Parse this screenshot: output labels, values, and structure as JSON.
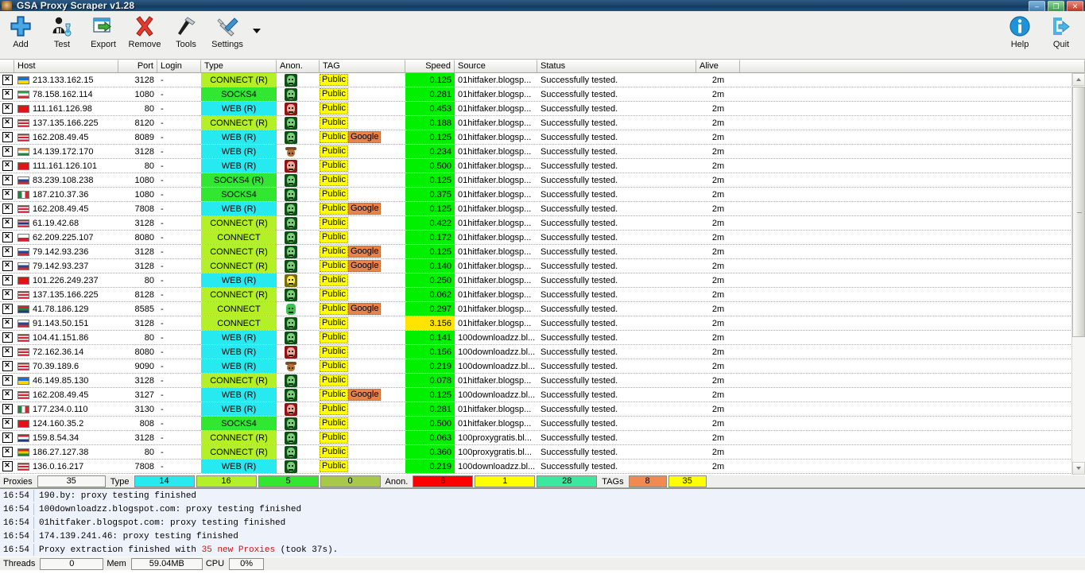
{
  "window": {
    "title": "GSA Proxy Scraper v1.28",
    "icon": "app-icon",
    "minimize_label": "–",
    "maximize_label": "❐",
    "close_label": "✕"
  },
  "toolbar": {
    "buttons": [
      {
        "label": "Add",
        "icon": "plus-icon"
      },
      {
        "label": "Test",
        "icon": "person-flask-icon"
      },
      {
        "label": "Export",
        "icon": "export-arrow-icon"
      },
      {
        "label": "Remove",
        "icon": "red-x-icon"
      },
      {
        "label": "Tools",
        "icon": "hammer-icon"
      },
      {
        "label": "Settings",
        "icon": "wrench-screwdriver-icon"
      }
    ],
    "overflow_icon": "chevron-down-icon",
    "right_buttons": [
      {
        "label": "Help",
        "icon": "info-icon"
      },
      {
        "label": "Quit",
        "icon": "exit-icon"
      }
    ]
  },
  "table": {
    "columns": [
      {
        "key": "check",
        "label": "",
        "align": "left"
      },
      {
        "key": "host",
        "label": "Host",
        "align": "left"
      },
      {
        "key": "port",
        "label": "Port",
        "align": "right"
      },
      {
        "key": "login",
        "label": "Login",
        "align": "left"
      },
      {
        "key": "type",
        "label": "Type",
        "align": "left"
      },
      {
        "key": "anon",
        "label": "Anon.",
        "align": "left"
      },
      {
        "key": "tag",
        "label": "TAG",
        "align": "left"
      },
      {
        "key": "speed",
        "label": "Speed",
        "align": "right"
      },
      {
        "key": "source",
        "label": "Source",
        "align": "left"
      },
      {
        "key": "status",
        "label": "Status",
        "align": "left"
      },
      {
        "key": "alive",
        "label": "Alive",
        "align": "left"
      }
    ],
    "rows": [
      {
        "checked": true,
        "flag": "ua",
        "host": "213.133.162.15",
        "port": "3128",
        "login": "-",
        "type": "CONNECT (R)",
        "type_color": "#b4f028",
        "anon": "elite",
        "tags": [
          "Public"
        ],
        "speed": "0.125",
        "speed_color": "#00f000",
        "source": "01hitfaker.blogsp...",
        "status": "Successfully tested.",
        "alive": "2m"
      },
      {
        "checked": true,
        "flag": "ir",
        "host": "78.158.162.114",
        "port": "1080",
        "login": "-",
        "type": "SOCKS4",
        "type_color": "#32e632",
        "anon": "elite",
        "tags": [
          "Public"
        ],
        "speed": "0.281",
        "speed_color": "#00f000",
        "source": "01hitfaker.blogsp...",
        "status": "Successfully tested.",
        "alive": "2m"
      },
      {
        "checked": true,
        "flag": "cn",
        "host": "111.161.126.98",
        "port": "80",
        "login": "-",
        "type": "WEB (R)",
        "type_color": "#27e9f0",
        "anon": "trans",
        "tags": [
          "Public"
        ],
        "speed": "0.453",
        "speed_color": "#00f000",
        "source": "01hitfaker.blogsp...",
        "status": "Successfully tested.",
        "alive": "2m"
      },
      {
        "checked": true,
        "flag": "us",
        "host": "137.135.166.225",
        "port": "8120",
        "login": "-",
        "type": "CONNECT (R)",
        "type_color": "#b4f028",
        "anon": "elite",
        "tags": [
          "Public"
        ],
        "speed": "0.188",
        "speed_color": "#00f000",
        "source": "01hitfaker.blogsp...",
        "status": "Successfully tested.",
        "alive": "2m"
      },
      {
        "checked": true,
        "flag": "us",
        "host": "162.208.49.45",
        "port": "8089",
        "login": "-",
        "type": "WEB (R)",
        "type_color": "#27e9f0",
        "anon": "elite",
        "tags": [
          "Public",
          "Google"
        ],
        "speed": "0.125",
        "speed_color": "#00f000",
        "source": "01hitfaker.blogsp...",
        "status": "Successfully tested.",
        "alive": "2m"
      },
      {
        "checked": true,
        "flag": "in",
        "host": "14.139.172.170",
        "port": "3128",
        "login": "-",
        "type": "WEB (R)",
        "type_color": "#27e9f0",
        "anon": "anon",
        "tags": [
          "Public"
        ],
        "speed": "0.234",
        "speed_color": "#00f000",
        "source": "01hitfaker.blogsp...",
        "status": "Successfully tested.",
        "alive": "2m"
      },
      {
        "checked": true,
        "flag": "cn",
        "host": "111.161.126.101",
        "port": "80",
        "login": "-",
        "type": "WEB (R)",
        "type_color": "#27e9f0",
        "anon": "trans",
        "tags": [
          "Public"
        ],
        "speed": "0.500",
        "speed_color": "#00f000",
        "source": "01hitfaker.blogsp...",
        "status": "Successfully tested.",
        "alive": "2m"
      },
      {
        "checked": true,
        "flag": "ru",
        "host": "83.239.108.238",
        "port": "1080",
        "login": "-",
        "type": "SOCKS4 (R)",
        "type_color": "#32e632",
        "anon": "elite",
        "tags": [
          "Public"
        ],
        "speed": "0.125",
        "speed_color": "#00f000",
        "source": "01hitfaker.blogsp...",
        "status": "Successfully tested.",
        "alive": "2m"
      },
      {
        "checked": true,
        "flag": "mx",
        "host": "187.210.37.36",
        "port": "1080",
        "login": "-",
        "type": "SOCKS4",
        "type_color": "#32e632",
        "anon": "elite",
        "tags": [
          "Public"
        ],
        "speed": "0.375",
        "speed_color": "#00f000",
        "source": "01hitfaker.blogsp...",
        "status": "Successfully tested.",
        "alive": "2m"
      },
      {
        "checked": true,
        "flag": "us",
        "host": "162.208.49.45",
        "port": "7808",
        "login": "-",
        "type": "WEB (R)",
        "type_color": "#27e9f0",
        "anon": "elite",
        "tags": [
          "Public",
          "Google"
        ],
        "speed": "0.125",
        "speed_color": "#00f000",
        "source": "01hitfaker.blogsp...",
        "status": "Successfully tested.",
        "alive": "2m"
      },
      {
        "checked": true,
        "flag": "th",
        "host": "61.19.42.68",
        "port": "3128",
        "login": "-",
        "type": "CONNECT (R)",
        "type_color": "#b4f028",
        "anon": "elite",
        "tags": [
          "Public"
        ],
        "speed": "0.422",
        "speed_color": "#00f000",
        "source": "01hitfaker.blogsp...",
        "status": "Successfully tested.",
        "alive": "2m"
      },
      {
        "checked": true,
        "flag": "cz",
        "host": "62.209.225.107",
        "port": "8080",
        "login": "-",
        "type": "CONNECT",
        "type_color": "#b4f028",
        "anon": "elite",
        "tags": [
          "Public"
        ],
        "speed": "0.172",
        "speed_color": "#00f000",
        "source": "01hitfaker.blogsp...",
        "status": "Successfully tested.",
        "alive": "2m"
      },
      {
        "checked": true,
        "flag": "ru",
        "host": "79.142.93.236",
        "port": "3128",
        "login": "-",
        "type": "CONNECT (R)",
        "type_color": "#b4f028",
        "anon": "elite",
        "tags": [
          "Public",
          "Google"
        ],
        "speed": "0.125",
        "speed_color": "#00f000",
        "source": "01hitfaker.blogsp...",
        "status": "Successfully tested.",
        "alive": "2m"
      },
      {
        "checked": true,
        "flag": "ru",
        "host": "79.142.93.237",
        "port": "3128",
        "login": "-",
        "type": "CONNECT (R)",
        "type_color": "#b4f028",
        "anon": "elite",
        "tags": [
          "Public",
          "Google"
        ],
        "speed": "0.140",
        "speed_color": "#00f000",
        "source": "01hitfaker.blogsp...",
        "status": "Successfully tested.",
        "alive": "2m"
      },
      {
        "checked": true,
        "flag": "cn",
        "host": "101.226.249.237",
        "port": "80",
        "login": "-",
        "type": "WEB (R)",
        "type_color": "#27e9f0",
        "anon": "yellow",
        "tags": [
          "Public"
        ],
        "speed": "0.250",
        "speed_color": "#00f000",
        "source": "01hitfaker.blogsp...",
        "status": "Successfully tested.",
        "alive": "2m"
      },
      {
        "checked": true,
        "flag": "us",
        "host": "137.135.166.225",
        "port": "8128",
        "login": "-",
        "type": "CONNECT (R)",
        "type_color": "#b4f028",
        "anon": "elite",
        "tags": [
          "Public"
        ],
        "speed": "0.062",
        "speed_color": "#00f000",
        "source": "01hitfaker.blogsp...",
        "status": "Successfully tested.",
        "alive": "2m"
      },
      {
        "checked": true,
        "flag": "za",
        "host": "41.78.186.129",
        "port": "8585",
        "login": "-",
        "type": "CONNECT",
        "type_color": "#b4f028",
        "anon": "green",
        "tags": [
          "Public",
          "Google"
        ],
        "speed": "0.297",
        "speed_color": "#00f000",
        "source": "01hitfaker.blogsp...",
        "status": "Successfully tested.",
        "alive": "2m"
      },
      {
        "checked": true,
        "flag": "ru",
        "host": "91.143.50.151",
        "port": "3128",
        "login": "-",
        "type": "CONNECT",
        "type_color": "#b4f028",
        "anon": "elite",
        "tags": [
          "Public"
        ],
        "speed": "3.156",
        "speed_color": "#ffe400",
        "source": "01hitfaker.blogsp...",
        "status": "Successfully tested.",
        "alive": "2m"
      },
      {
        "checked": true,
        "flag": "us",
        "host": "104.41.151.86",
        "port": "80",
        "login": "-",
        "type": "WEB (R)",
        "type_color": "#27e9f0",
        "anon": "elite",
        "tags": [
          "Public"
        ],
        "speed": "0.141",
        "speed_color": "#00f000",
        "source": "100downloadzz.bl...",
        "status": "Successfully tested.",
        "alive": "2m"
      },
      {
        "checked": true,
        "flag": "us",
        "host": "72.162.36.14",
        "port": "8080",
        "login": "-",
        "type": "WEB (R)",
        "type_color": "#27e9f0",
        "anon": "trans",
        "tags": [
          "Public"
        ],
        "speed": "0.156",
        "speed_color": "#00f000",
        "source": "100downloadzz.bl...",
        "status": "Successfully tested.",
        "alive": "2m"
      },
      {
        "checked": true,
        "flag": "us",
        "host": "70.39.189.6",
        "port": "9090",
        "login": "-",
        "type": "WEB (R)",
        "type_color": "#27e9f0",
        "anon": "anon",
        "tags": [
          "Public"
        ],
        "speed": "0.219",
        "speed_color": "#00f000",
        "source": "100downloadzz.bl...",
        "status": "Successfully tested.",
        "alive": "2m"
      },
      {
        "checked": true,
        "flag": "ua",
        "host": "46.149.85.130",
        "port": "3128",
        "login": "-",
        "type": "CONNECT (R)",
        "type_color": "#b4f028",
        "anon": "elite",
        "tags": [
          "Public"
        ],
        "speed": "0.078",
        "speed_color": "#00f000",
        "source": "01hitfaker.blogsp...",
        "status": "Successfully tested.",
        "alive": "2m"
      },
      {
        "checked": true,
        "flag": "us",
        "host": "162.208.49.45",
        "port": "3127",
        "login": "-",
        "type": "WEB (R)",
        "type_color": "#27e9f0",
        "anon": "elite",
        "tags": [
          "Public",
          "Google"
        ],
        "speed": "0.125",
        "speed_color": "#00f000",
        "source": "100downloadzz.bl...",
        "status": "Successfully tested.",
        "alive": "2m"
      },
      {
        "checked": true,
        "flag": "mx",
        "host": "177.234.0.110",
        "port": "3130",
        "login": "-",
        "type": "WEB (R)",
        "type_color": "#27e9f0",
        "anon": "trans",
        "tags": [
          "Public"
        ],
        "speed": "0.281",
        "speed_color": "#00f000",
        "source": "01hitfaker.blogsp...",
        "status": "Successfully tested.",
        "alive": "2m"
      },
      {
        "checked": true,
        "flag": "cn",
        "host": "124.160.35.2",
        "port": "808",
        "login": "-",
        "type": "SOCKS4",
        "type_color": "#32e632",
        "anon": "elite",
        "tags": [
          "Public"
        ],
        "speed": "0.500",
        "speed_color": "#00f000",
        "source": "01hitfaker.blogsp...",
        "status": "Successfully tested.",
        "alive": "2m"
      },
      {
        "checked": true,
        "flag": "nl",
        "host": "159.8.54.34",
        "port": "3128",
        "login": "-",
        "type": "CONNECT (R)",
        "type_color": "#b4f028",
        "anon": "elite",
        "tags": [
          "Public"
        ],
        "speed": "0.063",
        "speed_color": "#00f000",
        "source": "100proxygratis.bl...",
        "status": "Successfully tested.",
        "alive": "2m"
      },
      {
        "checked": true,
        "flag": "bo",
        "host": "186.27.127.38",
        "port": "80",
        "login": "-",
        "type": "CONNECT (R)",
        "type_color": "#b4f028",
        "anon": "elite",
        "tags": [
          "Public"
        ],
        "speed": "0.360",
        "speed_color": "#00f000",
        "source": "100proxygratis.bl...",
        "status": "Successfully tested.",
        "alive": "2m"
      },
      {
        "checked": true,
        "flag": "us",
        "host": "136.0.16.217",
        "port": "7808",
        "login": "-",
        "type": "WEB (R)",
        "type_color": "#27e9f0",
        "anon": "elite",
        "tags": [
          "Public"
        ],
        "speed": "0.219",
        "speed_color": "#00f000",
        "source": "100downloadzz.bl...",
        "status": "Successfully tested.",
        "alive": "2m"
      }
    ]
  },
  "counters": {
    "proxies_label": "Proxies",
    "proxies_value": "35",
    "type_label": "Type",
    "type_values": [
      {
        "value": "14",
        "color": "#27e9f0"
      },
      {
        "value": "16",
        "color": "#b4f028"
      },
      {
        "value": "5",
        "color": "#32e632"
      },
      {
        "value": "0",
        "color": "#a8c84a"
      }
    ],
    "anon_label": "Anon.",
    "anon_values": [
      {
        "value": "6",
        "color": "#ff0000"
      },
      {
        "value": "1",
        "color": "#ffff00"
      },
      {
        "value": "28",
        "color": "#3ce8a0"
      }
    ],
    "tags_label": "TAGs",
    "tags_values": [
      {
        "value": "8",
        "color": "#f08a50"
      },
      {
        "value": "35",
        "color": "#ffff00"
      }
    ]
  },
  "log": {
    "lines": [
      {
        "time": "16:54",
        "text": "190.by: proxy testing finished"
      },
      {
        "time": "16:54",
        "text": "100downloadzz.blogspot.com: proxy testing finished"
      },
      {
        "time": "16:54",
        "text": "01hitfaker.blogspot.com: proxy testing finished"
      },
      {
        "time": "16:54",
        "text": "174.139.241.46: proxy testing finished"
      },
      {
        "time": "16:54",
        "pre": "Proxy extraction finished with ",
        "highlight": "35 new Proxies",
        "post": " (took 37s)."
      }
    ]
  },
  "statusbar": {
    "threads_label": "Threads",
    "threads_value": "0",
    "mem_label": "Mem",
    "mem_value": "59.04MB",
    "cpu_label": "CPU",
    "cpu_value": "0%"
  }
}
